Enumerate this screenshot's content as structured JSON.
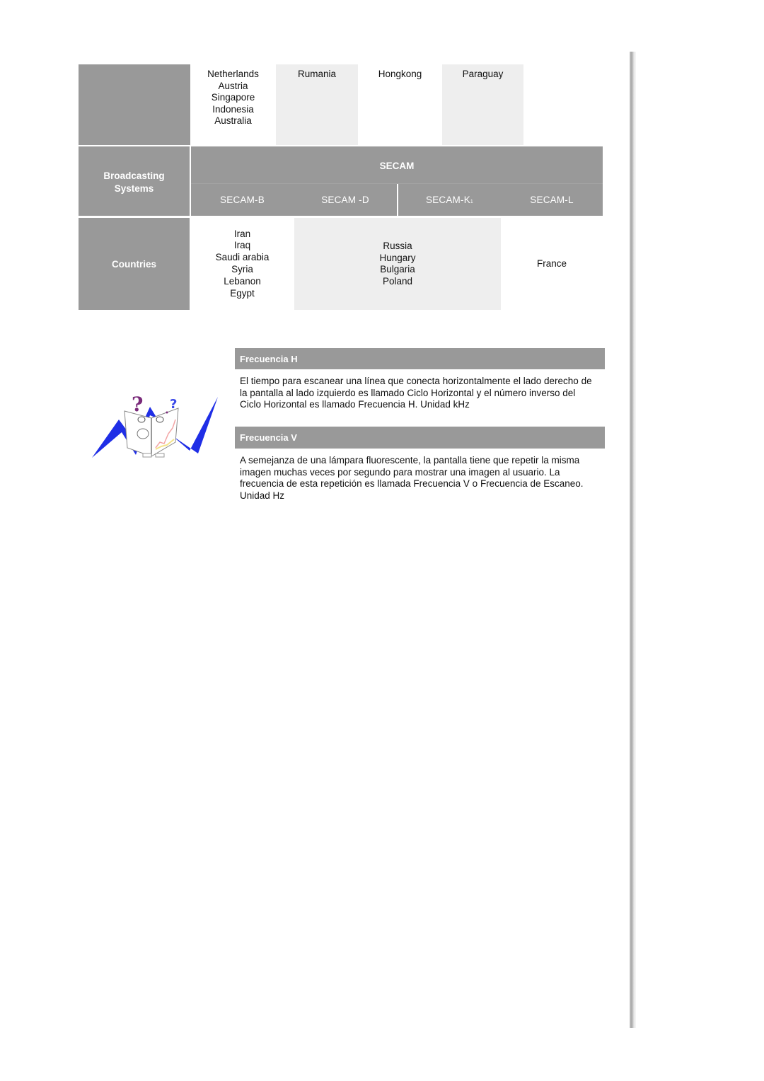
{
  "top_row": {
    "columns": [
      {
        "countries": [
          "Netherlands",
          "Austria",
          "Singapore",
          "Indonesia",
          "Australia"
        ]
      },
      {
        "countries": [
          "Rumania"
        ]
      },
      {
        "countries": [
          "Hongkong"
        ]
      },
      {
        "countries": [
          "Paraguay"
        ]
      }
    ]
  },
  "broadcast_table": {
    "row_header": "Broadcasting Systems",
    "row_header_lines": [
      "Broadcasting",
      "Systems"
    ],
    "system_title": "SECAM",
    "sub_systems": [
      "SECAM-B",
      "SECAM-D",
      "SECAM-K1",
      "SECAM-L"
    ],
    "sub_systems_display": [
      "SECAM-B",
      "SECAM -D",
      "SECAM-K",
      "SECAM-L"
    ],
    "countries_header": "Countries",
    "country_groups": [
      {
        "systems": "SECAM-B",
        "countries": [
          "Iran",
          "Iraq",
          "Saudi arabia",
          "Syria",
          "Lebanon",
          "Egypt"
        ]
      },
      {
        "systems": "SECAM-D, SECAM-K1",
        "countries": [
          "Russia",
          "Hungary",
          "Bulgaria",
          "Poland"
        ]
      },
      {
        "systems": "SECAM-L",
        "countries": [
          "France"
        ]
      }
    ]
  },
  "sections": [
    {
      "title": "Frecuencia H",
      "body": "El tiempo para escanear una línea que conecta horizontalmente el lado derecho de la pantalla al lado izquierdo es llamado Ciclo Horizontal y el número inverso del Ciclo Horizontal es llamado Frecuencia H. Unidad kHz"
    },
    {
      "title": "Frecuencia V",
      "body": "A semejanza de una lámpara fluorescente, la pantalla tiene que repetir la misma imagen muchas veces por segundo para mostrar una imagen al usuario. La frecuencia de esta repetición es llamada Frecuencia V o Frecuencia de Escaneo. Unidad Hz"
    }
  ],
  "illustration": {
    "icon": "confused-book-mascot-icon"
  },
  "colors": {
    "header_gray": "#999999",
    "cell_light": "#eeeeee",
    "mascot_blue": "#1f2ee6",
    "question_purple": "#7a2a7a"
  }
}
